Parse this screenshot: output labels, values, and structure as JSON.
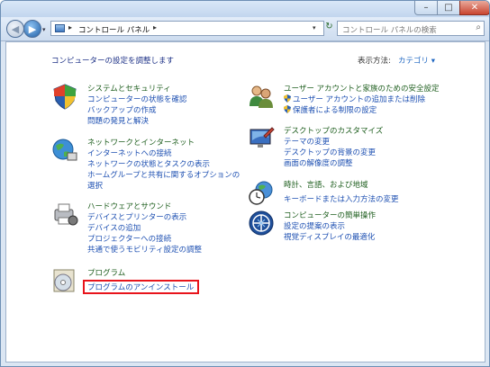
{
  "window": {
    "minimize_label": "–",
    "maximize_label": "□",
    "close_label": "✕"
  },
  "nav": {
    "back_glyph": "◀",
    "forward_glyph": "▶",
    "recent_glyph": "▾",
    "breadcrumb_sep": "▸",
    "breadcrumb": "コントロール パネル",
    "breadcrumb_trail": "▸",
    "address_dropdown": "▾",
    "refresh_glyph": "↻",
    "search_placeholder": "コントロール パネルの検索",
    "search_glyph": "⌕"
  },
  "header": {
    "title": "コンピューターの設定を調整します",
    "view_by_label": "表示方法:",
    "view_by_value": "カテゴリ ▾"
  },
  "categories": [
    {
      "title": "システムとセキュリティ",
      "links": [
        "コンピューターの状態を確認",
        "バックアップの作成",
        "問題の発見と解決"
      ]
    },
    {
      "title": "ネットワークとインターネット",
      "links": [
        "インターネットへの接続",
        "ネットワークの状態とタスクの表示",
        "ホームグループと共有に関するオプションの",
        "選択"
      ]
    },
    {
      "title": "ハードウェアとサウンド",
      "links": [
        "デバイスとプリンターの表示",
        "デバイスの追加",
        "プロジェクターへの接続",
        "共通で使うモビリティ設定の調整"
      ]
    },
    {
      "title": "プログラム",
      "links": [
        "プログラムのアンインストール"
      ]
    },
    {
      "title": "ユーザー アカウントと家族のための安全設定",
      "links": [
        "ユーザー アカウントの追加または削除",
        "保護者による制限の設定"
      ]
    },
    {
      "title": "デスクトップのカスタマイズ",
      "links": [
        "テーマの変更",
        "デスクトップの背景の変更",
        "画面の解像度の調整"
      ]
    },
    {
      "title": "時計、言語、および地域",
      "links": [
        "キーボードまたは入力方法の変更"
      ]
    },
    {
      "title": "コンピューターの簡単操作",
      "links": [
        "設定の提案の表示",
        "視覚ディスプレイの最適化"
      ]
    }
  ],
  "colors": {
    "highlight": "#e8141b",
    "link": "#1e50b2",
    "category_title": "#1e5e1e"
  }
}
